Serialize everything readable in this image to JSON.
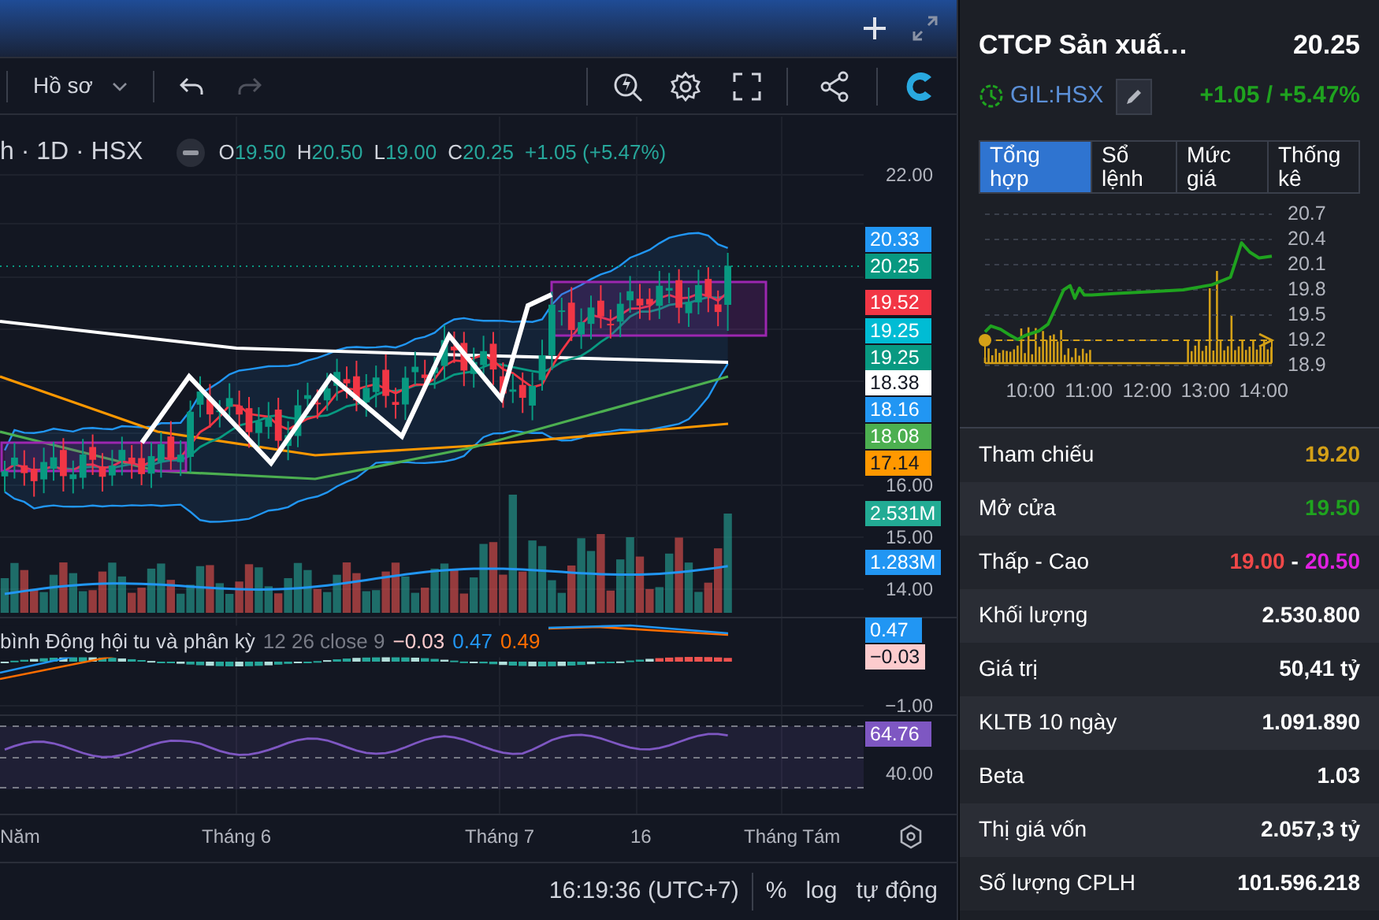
{
  "toolbar": {
    "profile_label": "Hồ sơ"
  },
  "legend": {
    "symbol": "h · 1D · HSX",
    "ohlc": [
      {
        "label": "O",
        "value": "19.50"
      },
      {
        "label": "H",
        "value": "20.50"
      },
      {
        "label": "L",
        "value": "19.00"
      },
      {
        "label": "C",
        "value": "20.25"
      }
    ],
    "change": "+1.05 (+5.47%)"
  },
  "price_axis": {
    "labels": [
      "22.00",
      "16.00",
      "15.00",
      "14.00"
    ],
    "badges": [
      {
        "text": "20.33",
        "color": "#2196f3"
      },
      {
        "text": "20.25",
        "color": "#089981"
      },
      {
        "text": "19.52",
        "color": "#f23645"
      },
      {
        "text": "19.25",
        "color": "#00bcd4"
      },
      {
        "text": "19.25",
        "color": "#089981"
      },
      {
        "text": "18.38",
        "color": "#ffffff"
      },
      {
        "text": "18.16",
        "color": "#2196f3"
      },
      {
        "text": "18.08",
        "color": "#4caf50"
      },
      {
        "text": "17.14",
        "color": "#ff9800"
      },
      {
        "text": "2.531M",
        "color": "#22ab94"
      },
      {
        "text": "1.283M",
        "color": "#2196f3"
      }
    ]
  },
  "macd": {
    "name": "bình Động hội tu và phân kỳ",
    "params": "12 26 close 9",
    "values": [
      {
        "text": "−0.03",
        "color": "#fccbcd"
      },
      {
        "text": "0.47",
        "color": "#2196f3"
      },
      {
        "text": "0.49",
        "color": "#ff6d00"
      }
    ],
    "badges": [
      {
        "text": "0.47",
        "color": "#2196f3"
      },
      {
        "text": "−0.03",
        "color": "#fccbcd"
      }
    ],
    "axis_label": "−1.00"
  },
  "rsi": {
    "badge": {
      "text": "64.76",
      "color": "#7e57c2"
    },
    "axis_label": "40.00"
  },
  "time_axis": [
    "Năm",
    "Tháng 6",
    "Tháng 7",
    "16",
    "Tháng Tám"
  ],
  "status_bar": {
    "time": "16:19:36 (UTC+7)",
    "buttons": [
      "%",
      "log",
      "tự động"
    ]
  },
  "quote": {
    "name": "CTCP Sản xuấ…",
    "price": "20.25",
    "symbol": "GIL:HSX",
    "change": "+1.05 / +5.47%"
  },
  "tabs": [
    {
      "label": "Tổng hợp",
      "selected": true
    },
    {
      "label": "Sổ lệnh",
      "selected": false
    },
    {
      "label": "Mức giá",
      "selected": false
    },
    {
      "label": "Thống kê",
      "selected": false
    }
  ],
  "intraday": {
    "chart_data": {
      "type": "line",
      "x": [
        9.22,
        9.32,
        9.49,
        9.65,
        9.78,
        9.92,
        10.14,
        10.3,
        10.46,
        10.57,
        10.68,
        10.76,
        10.84,
        10.92,
        11.05,
        11.54,
        12.08,
        12.62,
        13.11,
        13.22,
        13.43,
        13.51,
        13.62,
        13.76,
        13.92,
        14.14
      ],
      "series": [
        {
          "color": "#1fa31f",
          "values": [
            19.3,
            19.37,
            19.33,
            19.26,
            19.21,
            19.26,
            19.31,
            19.39,
            19.63,
            19.8,
            19.85,
            19.7,
            19.82,
            19.74,
            19.74,
            19.76,
            19.78,
            19.8,
            19.86,
            19.89,
            19.95,
            20.12,
            20.36,
            20.25,
            20.18,
            20.2
          ]
        }
      ],
      "xlim": [
        9.22,
        14.14
      ],
      "ylim": [
        18.9,
        20.7
      ],
      "grid": true,
      "ref_lines": [
        {
          "axis": "y",
          "value": 19.2,
          "color": "#d4a017"
        }
      ],
      "yticks": [
        {
          "value": 20.7,
          "label": "20.7"
        },
        {
          "value": 20.4,
          "label": "20.4"
        },
        {
          "value": 20.1,
          "label": "20.1"
        },
        {
          "value": 19.8,
          "label": "19.8"
        },
        {
          "value": 19.5,
          "label": "19.5"
        },
        {
          "value": 19.2,
          "label": "19.2"
        },
        {
          "value": 18.9,
          "label": "18.9"
        }
      ],
      "xticks": [
        {
          "value": 10,
          "label": "10:00"
        },
        {
          "value": 11,
          "label": "11:00"
        },
        {
          "value": 12,
          "label": "12:00"
        },
        {
          "value": 13,
          "label": "13:00"
        },
        {
          "value": 14,
          "label": "14:00"
        }
      ]
    }
  },
  "stats": [
    {
      "label": "Tham chiếu",
      "values": [
        {
          "text": "19.20",
          "color": "#d4a017"
        }
      ]
    },
    {
      "label": "Mở cửa",
      "values": [
        {
          "text": "19.50",
          "color": "#1fa31f"
        }
      ]
    },
    {
      "label": "Thấp - Cao",
      "values": [
        {
          "text": "19.00",
          "color": "#f04848"
        },
        {
          "text": "-",
          "color": "#ffffff"
        },
        {
          "text": "20.50",
          "color": "#e020e0"
        }
      ]
    },
    {
      "label": "Khối lượng",
      "values": [
        {
          "text": "2.530.800",
          "color": "#ffffff"
        }
      ]
    },
    {
      "label": "Giá trị",
      "values": [
        {
          "text": "50,41 tỷ",
          "color": "#ffffff"
        }
      ]
    },
    {
      "label": "KLTB 10 ngày",
      "values": [
        {
          "text": "1.091.890",
          "color": "#ffffff"
        }
      ]
    },
    {
      "label": "Beta",
      "values": [
        {
          "text": "1.03",
          "color": "#ffffff"
        }
      ]
    },
    {
      "label": "Thị giá vốn",
      "values": [
        {
          "text": "2.057,3 tỷ",
          "color": "#ffffff"
        }
      ]
    },
    {
      "label": "Số lượng CPLH",
      "values": [
        {
          "text": "101.596.218",
          "color": "#ffffff"
        }
      ]
    }
  ]
}
